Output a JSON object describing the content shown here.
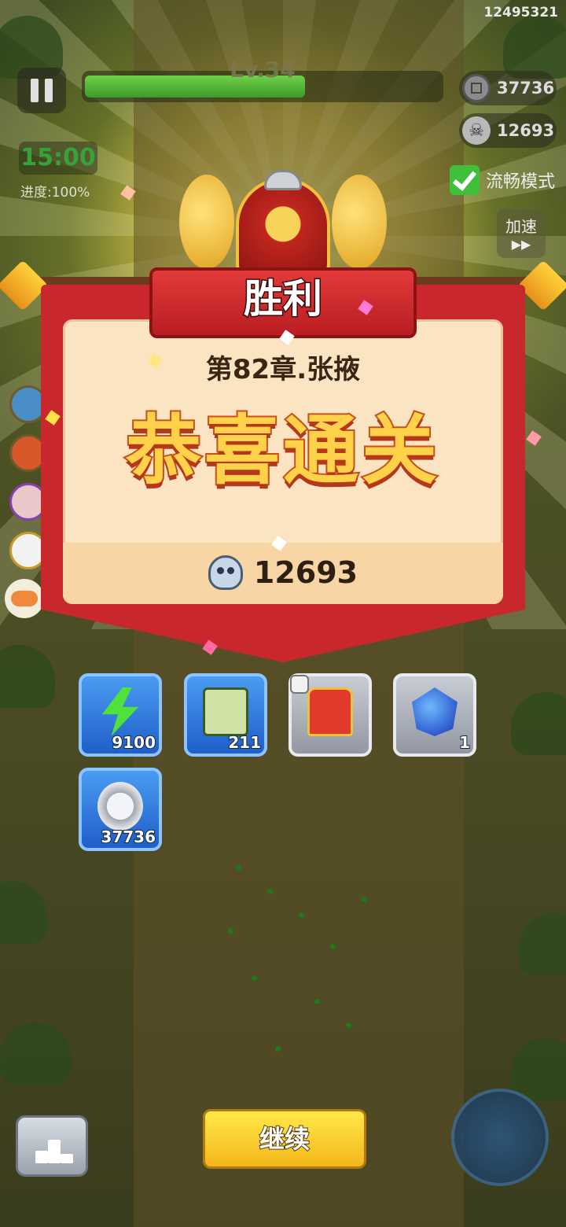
{
  "player_id": "12495321",
  "level": {
    "label": "Lv.34",
    "progress": 0.62
  },
  "currencies": {
    "coins": "37736",
    "skulls": "12693"
  },
  "timer": "15:00",
  "progress_text": "进度:100%",
  "smooth_mode": "流畅模式",
  "speed_label": "加速",
  "speed_arrows": "▶▶",
  "result": {
    "title": "胜利",
    "chapter": "第82章.张掖",
    "headline": "恭喜通关",
    "skull_total": "12693"
  },
  "rewards": [
    {
      "icon": "energy-bolt-icon",
      "count": "9100"
    },
    {
      "icon": "scroll-icon",
      "count": "211"
    },
    {
      "icon": "armor-icon",
      "count": ""
    },
    {
      "icon": "blue-gem-icon",
      "count": "1"
    },
    {
      "icon": "silver-coin-icon",
      "count": "37736"
    }
  ],
  "continue_label": "继续",
  "colors": {
    "banner_red": "#c8282b",
    "panel": "#fbe4c2",
    "button_yellow": "#f3b71a",
    "reward_blue": "#1f5ec8"
  }
}
